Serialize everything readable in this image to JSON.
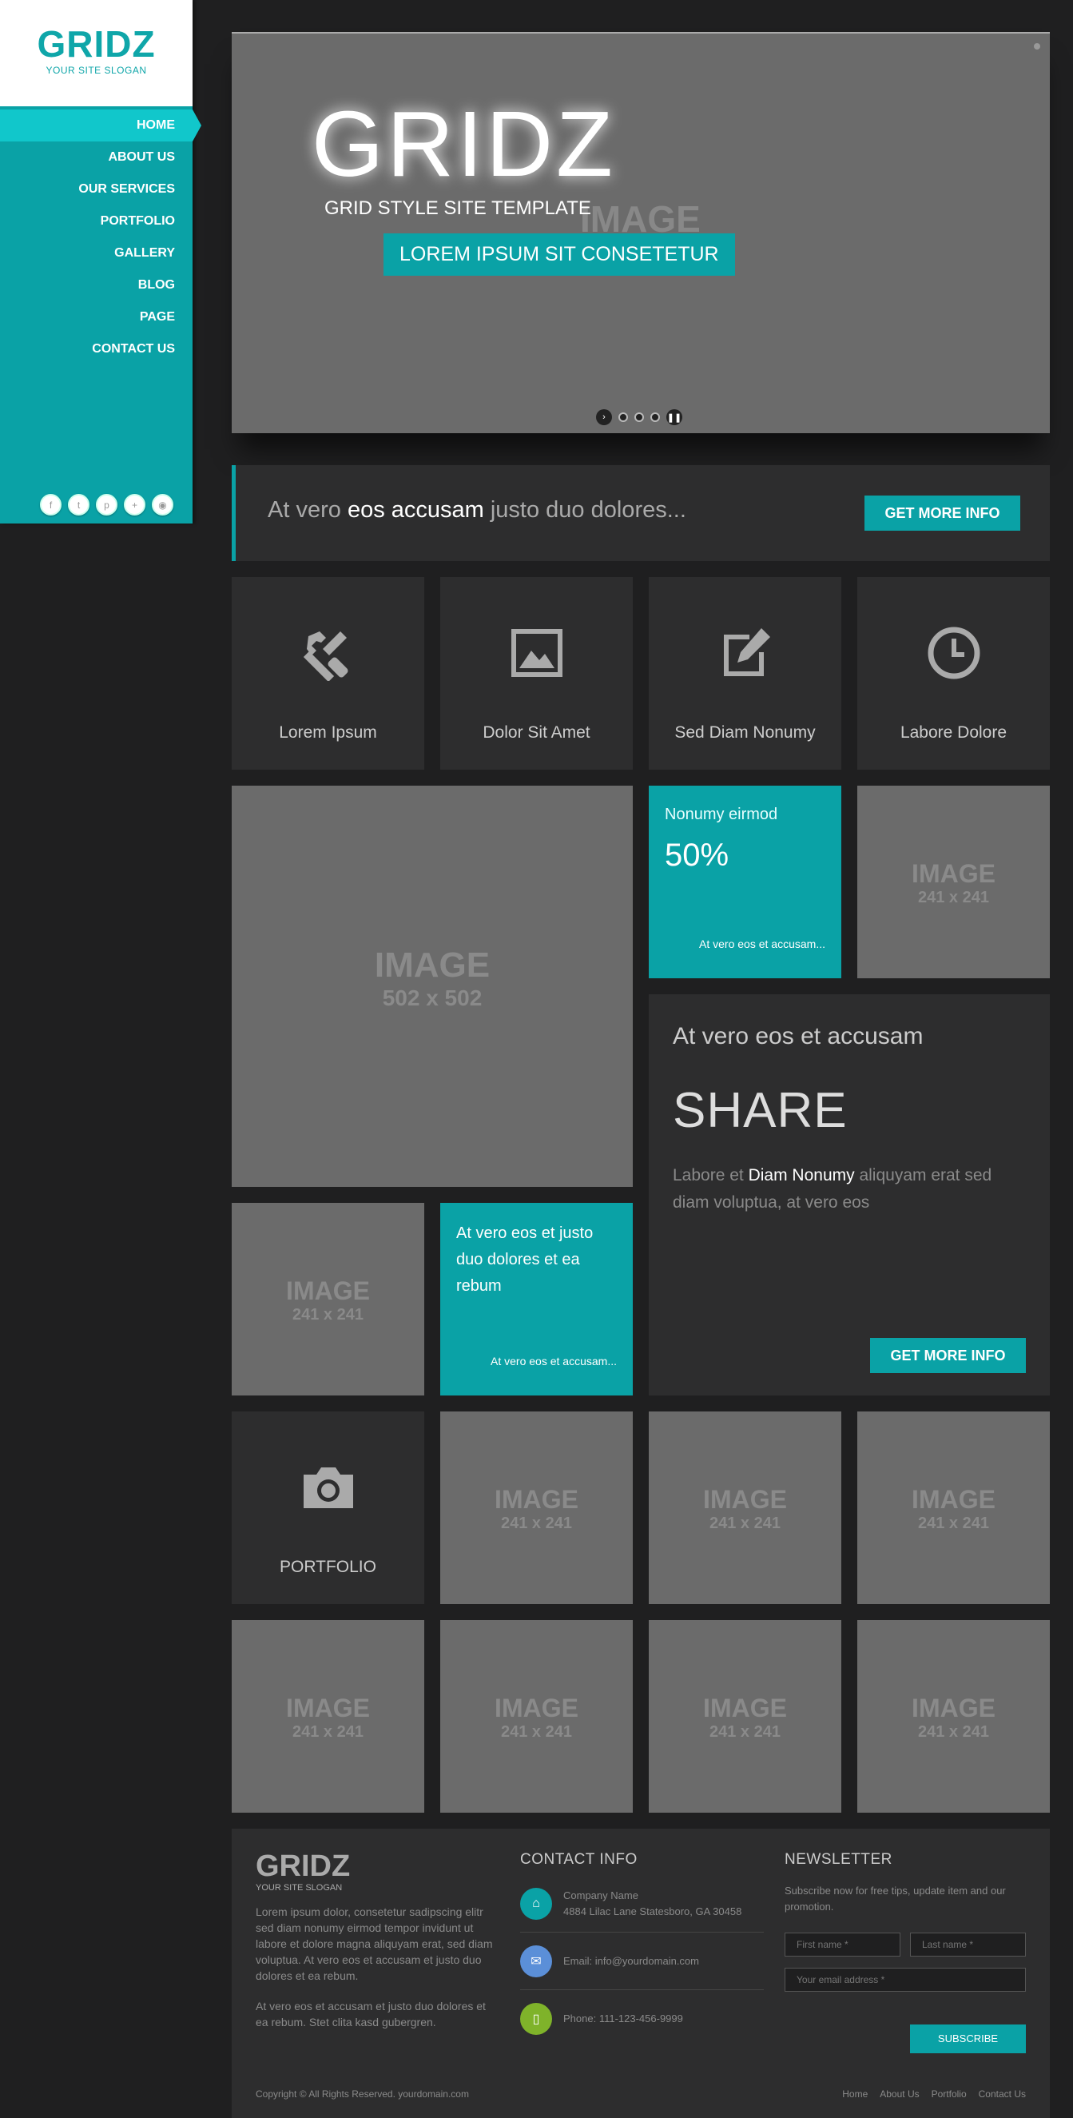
{
  "brand": {
    "logo": "GRIDZ",
    "slogan": "YOUR SITE SLOGAN"
  },
  "nav": [
    {
      "label": "HOME",
      "active": true
    },
    {
      "label": "ABOUT US"
    },
    {
      "label": "OUR SERVICES"
    },
    {
      "label": "PORTFOLIO"
    },
    {
      "label": "GALLERY"
    },
    {
      "label": "BLOG"
    },
    {
      "label": "PAGE"
    },
    {
      "label": "CONTACT US"
    }
  ],
  "socials": [
    "facebook-icon",
    "twitter-icon",
    "pinterest-icon",
    "googleplus-icon",
    "rss-icon"
  ],
  "slider": {
    "title": "GRIDZ",
    "subtitle": "GRID STYLE SITE TEMPLATE",
    "image_label": "IMAGE",
    "button": "LOREM IPSUM SIT CONSETETUR"
  },
  "promo": {
    "pre": "At vero ",
    "highlight": "eos accusam",
    "post": " justo duo dolores...",
    "button": "GET MORE INFO"
  },
  "services": [
    {
      "icon": "tools-icon",
      "label": "Lorem Ipsum"
    },
    {
      "icon": "picture-icon",
      "label": "Dolor Sit Amet"
    },
    {
      "icon": "edit-icon",
      "label": "Sed Diam Nonumy"
    },
    {
      "icon": "clock-icon",
      "label": "Labore Dolore"
    }
  ],
  "placeholder": {
    "title": "IMAGE",
    "big_size": "502 x 502",
    "small_size": "241 x 241"
  },
  "stat_tile": {
    "title": "Nonumy eirmod",
    "value": "50%",
    "link": "At vero eos et accusam..."
  },
  "text_tile": {
    "text": "At vero eos et justo duo dolores et ea rebum",
    "link": "At vero eos et accusam..."
  },
  "share": {
    "heading": "At vero eos et accusam",
    "big": "SHARE",
    "body_pre": "Labore et ",
    "body_highlight": "Diam Nonumy",
    "body_post": " aliquyam erat sed diam voluptua, at vero eos",
    "button": "GET MORE INFO"
  },
  "portfolio_tile": {
    "label": "PORTFOLIO",
    "icon": "camera-icon"
  },
  "footer": {
    "logo": "GRIDZ",
    "slogan": "YOUR SITE SLOGAN",
    "text1": "Lorem ipsum dolor, consetetur sadipscing elitr sed diam nonumy eirmod tempor invidunt ut labore et dolore magna aliquyam erat, sed diam voluptua. At vero eos et accusam et justo duo dolores et ea rebum.",
    "text2": "At vero eos et accusam et justo duo dolores et ea rebum. Stet clita kasd gubergren.",
    "contact_head": "CONTACT INFO",
    "contact": {
      "company": "Company Name",
      "address": "4884 Lilac Lane Statesboro, GA 30458",
      "email": "Email: info@yourdomain.com",
      "phone": "Phone: 111-123-456-9999"
    },
    "newsletter_head": "NEWSLETTER",
    "newsletter_text": "Subscribe now for free tips, update item and our promotion.",
    "first_name_ph": "First name *",
    "last_name_ph": "Last name *",
    "email_ph": "Your email address *",
    "subscribe": "SUBSCRIBE",
    "copyright": "Copyright © All Rights Reserved. yourdomain.com",
    "links": [
      "Home",
      "About Us",
      "Portfolio",
      "Contact Us"
    ]
  },
  "colors": {
    "accent": "#0aa2a6",
    "tile_dark": "#2d2d2e",
    "placeholder": "#6b6b6b",
    "background": "#1f1f20"
  }
}
